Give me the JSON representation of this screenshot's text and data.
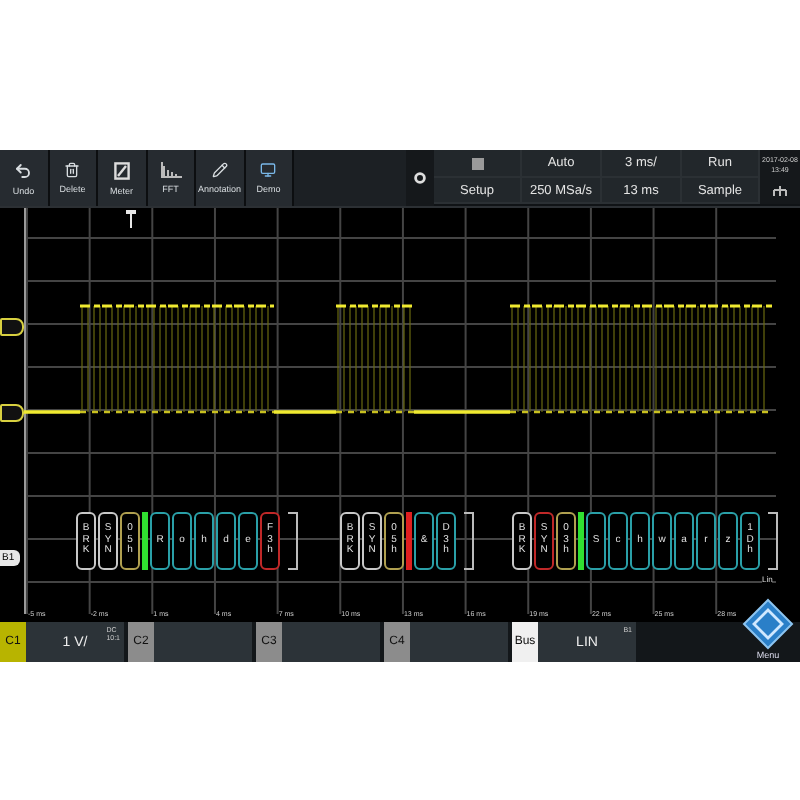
{
  "toolbar": [
    {
      "label": "Undo",
      "kind": "undo"
    },
    {
      "label": "Delete",
      "kind": "delete"
    },
    {
      "label": "Meter",
      "kind": "meter"
    },
    {
      "label": "FFT",
      "kind": "fft"
    },
    {
      "label": "Annotation",
      "kind": "annotation"
    },
    {
      "label": "Demo",
      "kind": "demo"
    }
  ],
  "acquisition": {
    "trigger_mode": "Auto",
    "time_scale": "3 ms/",
    "run_state": "Run",
    "setup": "Setup",
    "sample_rate": "250 MSa/s",
    "time_position": "13 ms",
    "acq_mode": "Sample",
    "date": "2017-02-08",
    "time": "13:49"
  },
  "plot": {
    "bus_tag": "B1",
    "time_labels": [
      "-5 ms",
      "-2 ms",
      "1 ms",
      "4 ms",
      "7 ms",
      "10 ms",
      "13 ms",
      "16 ms",
      "19 ms",
      "22 ms",
      "25 ms",
      "28 ms"
    ],
    "bus_name": "Lin",
    "frames": [
      {
        "segments": [
          {
            "kind": "field",
            "text": "BRK",
            "color": "#c8c8c8"
          },
          {
            "kind": "field",
            "text": "SYN",
            "color": "#c8c8c8"
          },
          {
            "kind": "field",
            "text": "05h",
            "color": "#b0a050"
          },
          {
            "kind": "marker",
            "color": "#30e030"
          },
          {
            "kind": "field",
            "text": "R",
            "color": "#2aa0a8"
          },
          {
            "kind": "field",
            "text": "o",
            "color": "#2aa0a8"
          },
          {
            "kind": "field",
            "text": "h",
            "color": "#2aa0a8"
          },
          {
            "kind": "field",
            "text": "d",
            "color": "#2aa0a8"
          },
          {
            "kind": "field",
            "text": "e",
            "color": "#2aa0a8"
          },
          {
            "kind": "field",
            "text": "F3h",
            "color": "#c02828"
          }
        ]
      },
      {
        "segments": [
          {
            "kind": "field",
            "text": "BRK",
            "color": "#c8c8c8"
          },
          {
            "kind": "field",
            "text": "SYN",
            "color": "#c8c8c8"
          },
          {
            "kind": "field",
            "text": "05h",
            "color": "#b0a050"
          },
          {
            "kind": "marker",
            "color": "#e02020"
          },
          {
            "kind": "field",
            "text": "&",
            "color": "#2aa0a8"
          },
          {
            "kind": "field",
            "text": "D3h",
            "color": "#2aa0a8"
          }
        ]
      },
      {
        "segments": [
          {
            "kind": "field",
            "text": "BRK",
            "color": "#c8c8c8"
          },
          {
            "kind": "field",
            "text": "SYN",
            "color": "#c02828"
          },
          {
            "kind": "field",
            "text": "03h",
            "color": "#b0a050"
          },
          {
            "kind": "marker",
            "color": "#30e030"
          },
          {
            "kind": "field",
            "text": "S",
            "color": "#2aa0a8"
          },
          {
            "kind": "field",
            "text": "c",
            "color": "#2aa0a8"
          },
          {
            "kind": "field",
            "text": "h",
            "color": "#2aa0a8"
          },
          {
            "kind": "field",
            "text": "w",
            "color": "#2aa0a8"
          },
          {
            "kind": "field",
            "text": "a",
            "color": "#2aa0a8"
          },
          {
            "kind": "field",
            "text": "r",
            "color": "#2aa0a8"
          },
          {
            "kind": "field",
            "text": "z",
            "color": "#2aa0a8"
          },
          {
            "kind": "field",
            "text": "1Dh",
            "color": "#2aa0a8"
          }
        ]
      }
    ]
  },
  "channels": [
    {
      "label": "C1",
      "value": "1 V/",
      "coupling": "DC",
      "probe": "10:1",
      "color": "#b8b400"
    },
    {
      "label": "C2",
      "color": "#8c8c8c"
    },
    {
      "label": "C3",
      "color": "#8c8c8c"
    },
    {
      "label": "C4",
      "color": "#8c8c8c"
    },
    {
      "label": "Bus",
      "value": "LIN",
      "sub": "B1",
      "color": "#f0f0f0"
    }
  ],
  "menu": {
    "label": "Menu"
  }
}
